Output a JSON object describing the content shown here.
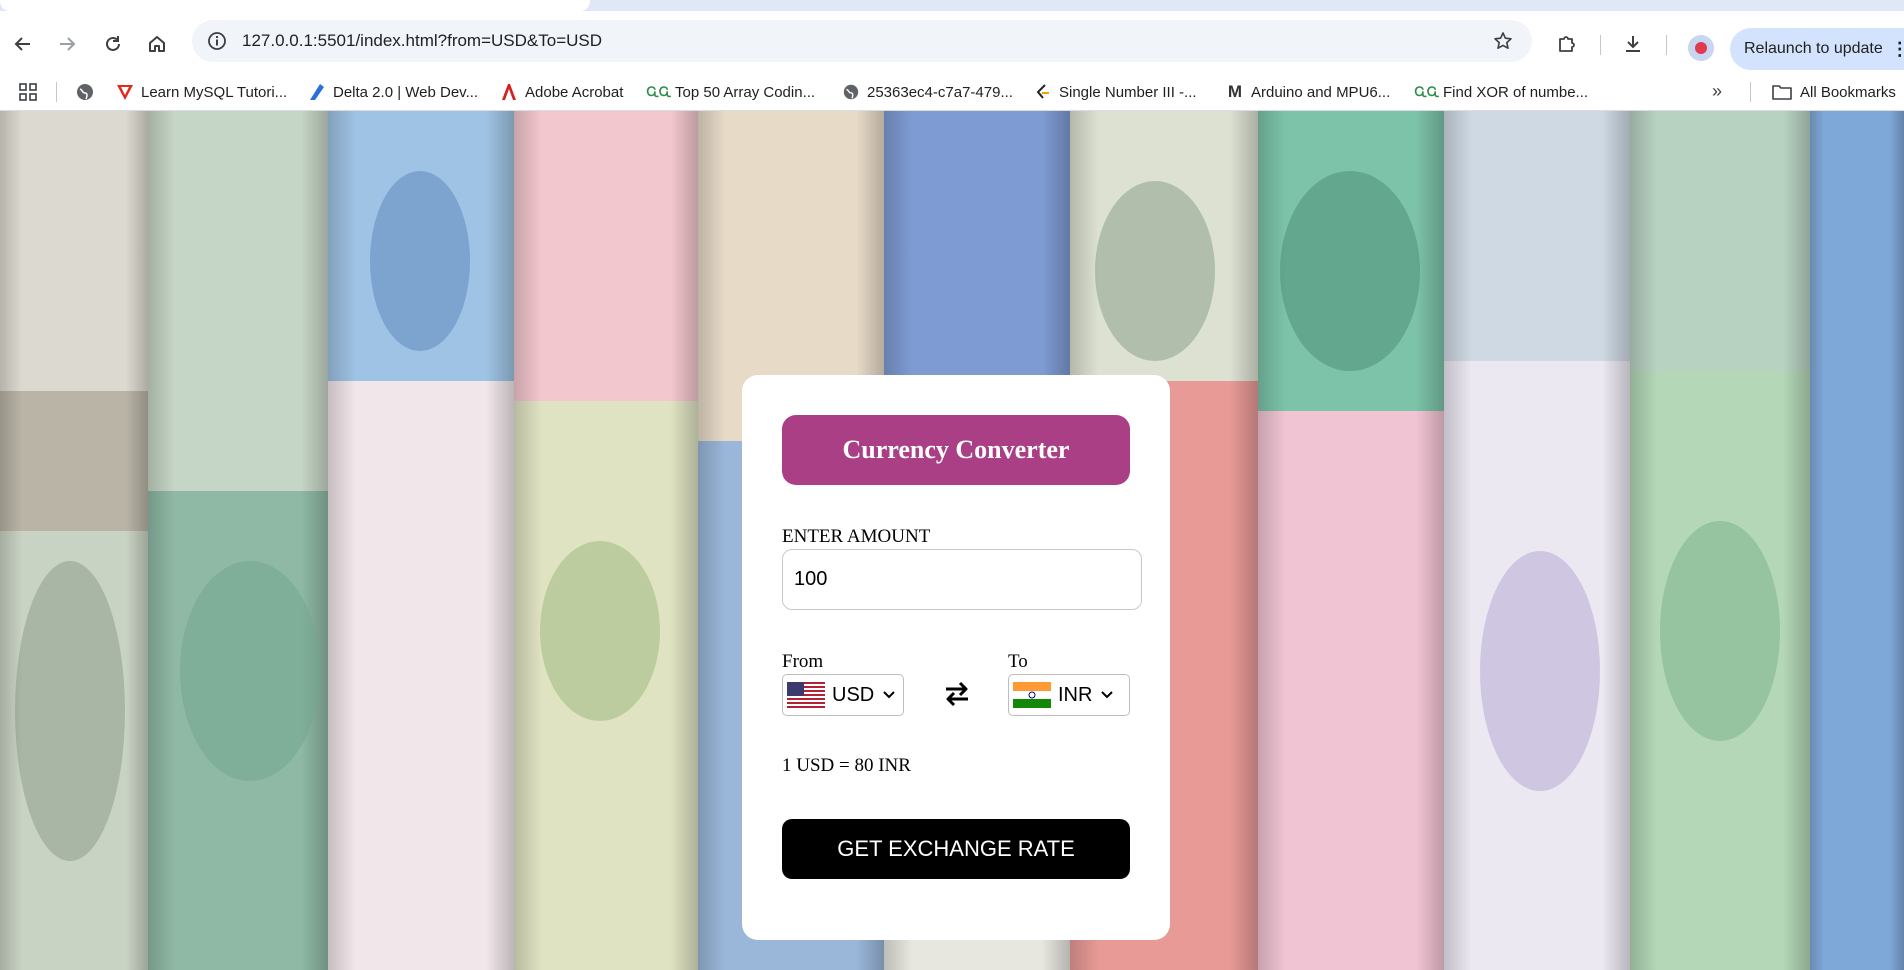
{
  "browser": {
    "url": "127.0.0.1:5501/index.html?from=USD&To=USD",
    "relaunch_label": "Relaunch to update",
    "bookmarks": [
      {
        "label": "Learn MySQL Tutori...",
        "icon": "red-v-icon"
      },
      {
        "label": "Delta 2.0 | Web Dev...",
        "icon": "delta-icon"
      },
      {
        "label": "Adobe Acrobat",
        "icon": "acrobat-icon"
      },
      {
        "label": "Top 50 Array Codin...",
        "icon": "gfg-icon"
      },
      {
        "label": "25363ec4-c7a7-479...",
        "icon": "globe-icon"
      },
      {
        "label": "Single Number III -...",
        "icon": "leetcode-icon"
      },
      {
        "label": "Arduino and MPU6...",
        "icon": "medium-icon"
      },
      {
        "label": "Find XOR of numbe...",
        "icon": "gfg-icon"
      }
    ],
    "all_bookmarks_label": "All Bookmarks"
  },
  "converter": {
    "title": "Currency Converter",
    "amount_label": "ENTER AMOUNT",
    "amount_value": "100",
    "from_label": "From",
    "to_label": "To",
    "from_currency": "USD",
    "to_currency": "INR",
    "rate_message": "1 USD = 80 INR",
    "button_label": "GET EXCHANGE RATE"
  },
  "colors": {
    "title_bg": "#ab3f86",
    "button_bg": "#000000",
    "card_bg": "#ffffff"
  }
}
